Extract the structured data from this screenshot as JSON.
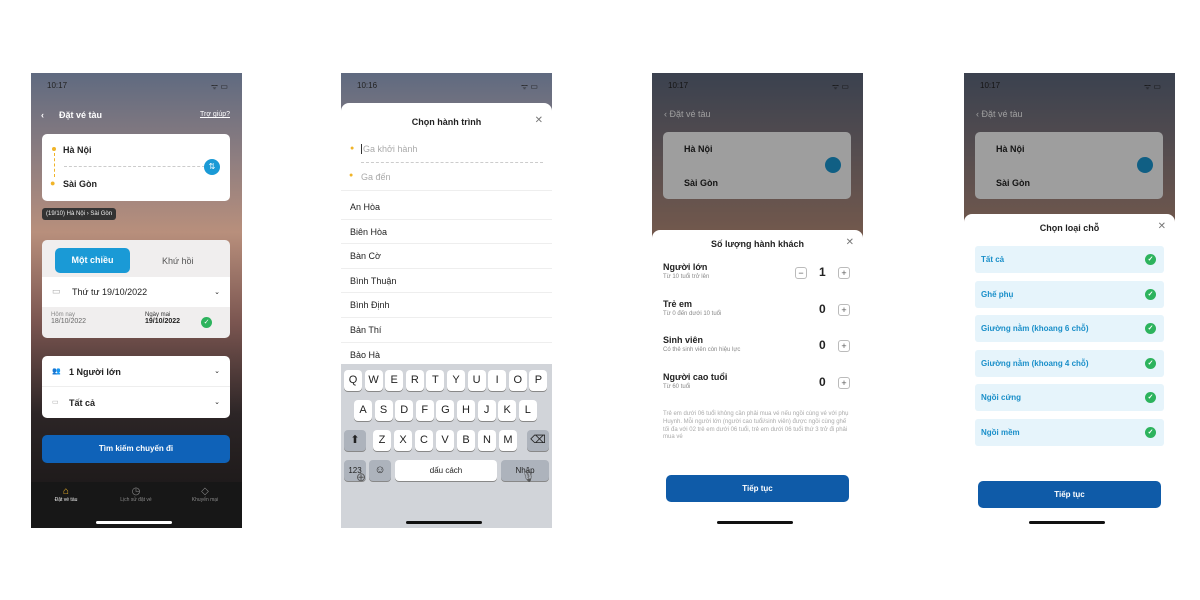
{
  "screen1": {
    "time": "10:17",
    "title": "Đặt vé tàu",
    "help": "Trợ giúp?",
    "from": "Hà Nội",
    "to": "Sài Gòn",
    "recent": "(19/10) Hà Nội",
    "recent_to": "Sài Gòn",
    "tab_oneway": "Một chiều",
    "tab_round": "Khứ hồi",
    "date": "Thứ tư 19/10/2022",
    "today_label": "Hôm nay",
    "today_date": "18/10/2022",
    "tomorrow_label": "Ngày mai",
    "tomorrow_date": "19/10/2022",
    "passengers": "1 Người lớn",
    "seat": "Tất cả",
    "search": "Tìm kiếm chuyến đi",
    "nav": [
      {
        "label": "Đặt vé tàu",
        "icon": "home-icon"
      },
      {
        "label": "Lịch sử đặt vé",
        "icon": "history-icon"
      },
      {
        "label": "Khuyến mại",
        "icon": "tag-icon"
      }
    ],
    "accent": "#1a9ad6"
  },
  "screen2": {
    "time": "10:16",
    "title": "Chọn hành trình",
    "from_placeholder": "Ga khởi hành",
    "to_placeholder": "Ga đến",
    "stations": [
      "An Hòa",
      "Biên Hòa",
      "Bàn Cờ",
      "Bình Thuận",
      "Bình Định",
      "Bản Thí",
      "Bảo Hà"
    ],
    "keys_row1": [
      "Q",
      "W",
      "E",
      "R",
      "T",
      "Y",
      "U",
      "I",
      "O",
      "P"
    ],
    "keys_row2": [
      "A",
      "S",
      "D",
      "F",
      "G",
      "H",
      "J",
      "K",
      "L"
    ],
    "keys_row3": [
      "Z",
      "X",
      "C",
      "V",
      "B",
      "N",
      "M"
    ],
    "key_123": "123",
    "key_space": "dấu cách",
    "key_enter": "Nhập"
  },
  "screen3": {
    "time": "10:17",
    "title": "Số lượng hành khách",
    "types": [
      {
        "name": "Người lớn",
        "desc": "Từ 10 tuổi trở lên",
        "count": "1"
      },
      {
        "name": "Trẻ em",
        "desc": "Từ 0 đến dưới 10 tuổi",
        "count": "0"
      },
      {
        "name": "Sinh viên",
        "desc": "Có thẻ sinh viên còn hiệu lực",
        "count": "0"
      },
      {
        "name": "Người cao tuổi",
        "desc": "Từ 60 tuổi",
        "count": "0"
      }
    ],
    "note": "Trẻ em dưới 06 tuổi không cần phải mua vé nếu ngồi cùng vé với phụ Huynh. Mỗi người lớn (người cao tuổi/sinh viên) được ngồi cùng ghế tối đa với 02 trẻ em dưới 06 tuổi, trẻ em dưới 06 tuổi thứ 3 trở đi phải mua vé",
    "continue": "Tiếp tục"
  },
  "screen4": {
    "time": "10:17",
    "title": "Chọn loại chỗ",
    "options": [
      "Tất cả",
      "Ghế phụ",
      "Giường nằm (khoang 6 chỗ)",
      "Giường nằm (khoang 4 chỗ)",
      "Ngồi cứng",
      "Ngồi mềm"
    ],
    "continue": "Tiếp tục"
  }
}
